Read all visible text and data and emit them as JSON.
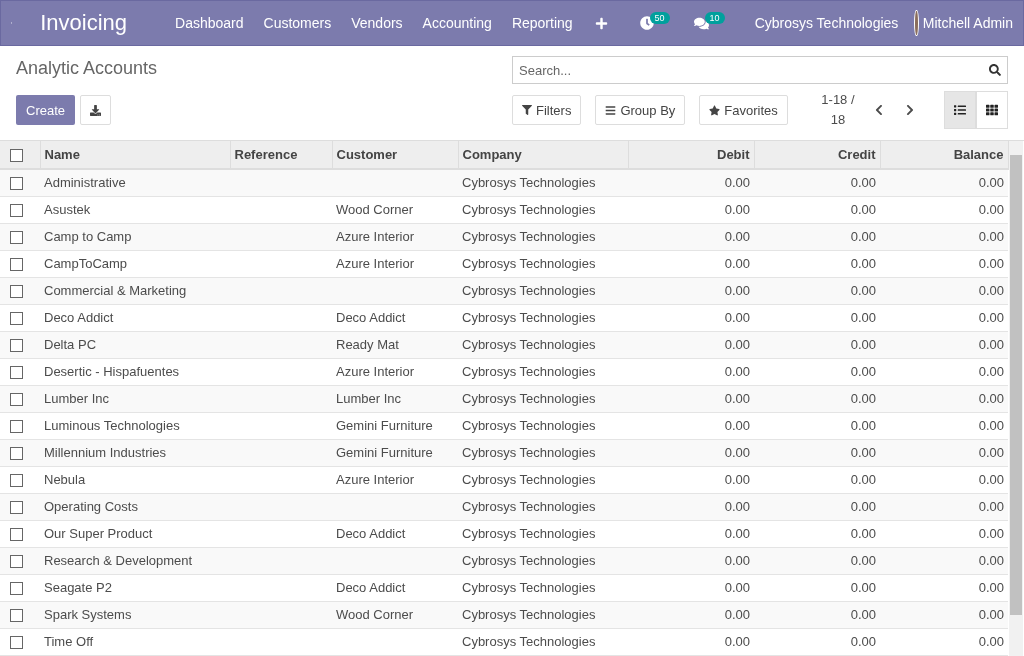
{
  "navbar": {
    "app_title": "Invoicing",
    "menu": [
      "Dashboard",
      "Customers",
      "Vendors",
      "Accounting",
      "Reporting"
    ],
    "activity_count": "50",
    "message_count": "10",
    "company": "Cybrosys Technologies",
    "user": "Mitchell Admin"
  },
  "control_panel": {
    "title": "Analytic Accounts",
    "create_button": "Create",
    "search": {
      "placeholder": "Search..."
    },
    "filters": "Filters",
    "group_by": "Group By",
    "favorites": "Favorites",
    "pager": "1-18 / 18",
    "views": [
      {
        "kind": "list",
        "selected": true
      },
      {
        "kind": "kanban",
        "selected": false
      }
    ]
  },
  "table": {
    "select_all_checked": false,
    "columns": [
      "Name",
      "Reference",
      "Customer",
      "Company",
      "Debit",
      "Credit",
      "Balance"
    ],
    "rows": [
      {
        "name": "Administrative",
        "reference": "",
        "customer": "",
        "company": "Cybrosys Technologies",
        "debit": "0.00",
        "credit": "0.00",
        "balance": "0.00",
        "checked": false
      },
      {
        "name": "Asustek",
        "reference": "",
        "customer": "Wood Corner",
        "company": "Cybrosys Technologies",
        "debit": "0.00",
        "credit": "0.00",
        "balance": "0.00",
        "checked": false
      },
      {
        "name": "Camp to Camp",
        "reference": "",
        "customer": "Azure Interior",
        "company": "Cybrosys Technologies",
        "debit": "0.00",
        "credit": "0.00",
        "balance": "0.00",
        "checked": false
      },
      {
        "name": "CampToCamp",
        "reference": "",
        "customer": "Azure Interior",
        "company": "Cybrosys Technologies",
        "debit": "0.00",
        "credit": "0.00",
        "balance": "0.00",
        "checked": false
      },
      {
        "name": "Commercial & Marketing",
        "reference": "",
        "customer": "",
        "company": "Cybrosys Technologies",
        "debit": "0.00",
        "credit": "0.00",
        "balance": "0.00",
        "checked": false
      },
      {
        "name": "Deco Addict",
        "reference": "",
        "customer": "Deco Addict",
        "company": "Cybrosys Technologies",
        "debit": "0.00",
        "credit": "0.00",
        "balance": "0.00",
        "checked": false
      },
      {
        "name": "Delta PC",
        "reference": "",
        "customer": "Ready Mat",
        "company": "Cybrosys Technologies",
        "debit": "0.00",
        "credit": "0.00",
        "balance": "0.00",
        "checked": false
      },
      {
        "name": "Desertic - Hispafuentes",
        "reference": "",
        "customer": "Azure Interior",
        "company": "Cybrosys Technologies",
        "debit": "0.00",
        "credit": "0.00",
        "balance": "0.00",
        "checked": false
      },
      {
        "name": "Lumber Inc",
        "reference": "",
        "customer": "Lumber Inc",
        "company": "Cybrosys Technologies",
        "debit": "0.00",
        "credit": "0.00",
        "balance": "0.00",
        "checked": false
      },
      {
        "name": "Luminous Technologies",
        "reference": "",
        "customer": "Gemini Furniture",
        "company": "Cybrosys Technologies",
        "debit": "0.00",
        "credit": "0.00",
        "balance": "0.00",
        "checked": false
      },
      {
        "name": "Millennium Industries",
        "reference": "",
        "customer": "Gemini Furniture",
        "company": "Cybrosys Technologies",
        "debit": "0.00",
        "credit": "0.00",
        "balance": "0.00",
        "checked": false
      },
      {
        "name": "Nebula",
        "reference": "",
        "customer": "Azure Interior",
        "company": "Cybrosys Technologies",
        "debit": "0.00",
        "credit": "0.00",
        "balance": "0.00",
        "checked": false
      },
      {
        "name": "Operating Costs",
        "reference": "",
        "customer": "",
        "company": "Cybrosys Technologies",
        "debit": "0.00",
        "credit": "0.00",
        "balance": "0.00",
        "checked": false
      },
      {
        "name": "Our Super Product",
        "reference": "",
        "customer": "Deco Addict",
        "company": "Cybrosys Technologies",
        "debit": "0.00",
        "credit": "0.00",
        "balance": "0.00",
        "checked": false
      },
      {
        "name": "Research & Development",
        "reference": "",
        "customer": "",
        "company": "Cybrosys Technologies",
        "debit": "0.00",
        "credit": "0.00",
        "balance": "0.00",
        "checked": false
      },
      {
        "name": "Seagate P2",
        "reference": "",
        "customer": "Deco Addict",
        "company": "Cybrosys Technologies",
        "debit": "0.00",
        "credit": "0.00",
        "balance": "0.00",
        "checked": false
      },
      {
        "name": "Spark Systems",
        "reference": "",
        "customer": "Wood Corner",
        "company": "Cybrosys Technologies",
        "debit": "0.00",
        "credit": "0.00",
        "balance": "0.00",
        "checked": false
      },
      {
        "name": "Time Off",
        "reference": "",
        "customer": "",
        "company": "Cybrosys Technologies",
        "debit": "0.00",
        "credit": "0.00",
        "balance": "0.00",
        "checked": false
      }
    ]
  }
}
